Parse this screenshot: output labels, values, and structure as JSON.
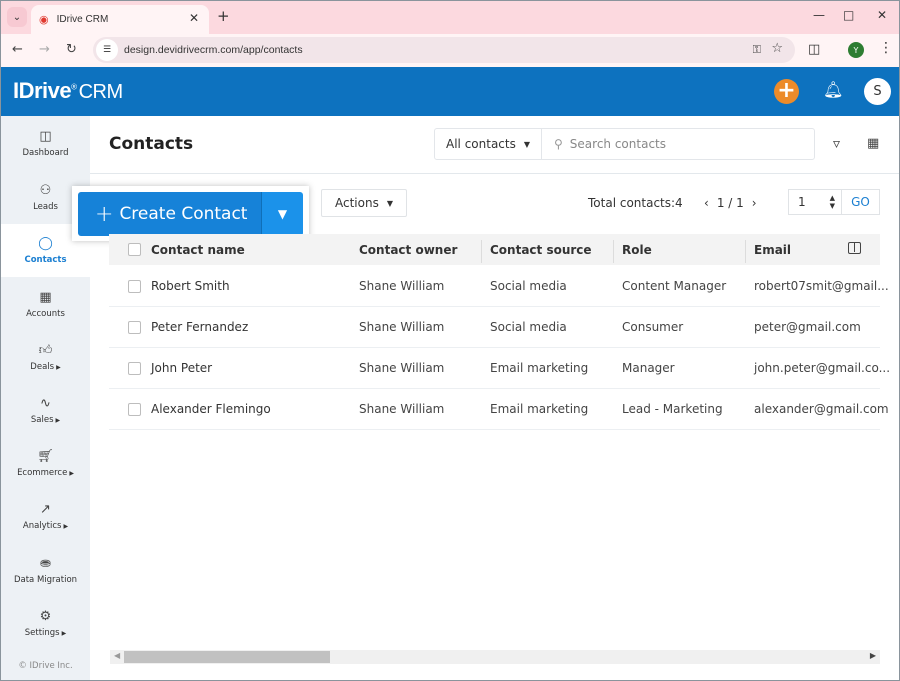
{
  "browser": {
    "tab_title": "IDrive CRM",
    "url": "design.devidrivecrm.com/app/contacts",
    "profile_initial": "Y"
  },
  "app": {
    "logo_brand": "IDrive",
    "logo_registered": "®",
    "logo_product": "CRM",
    "user_initial": "S",
    "accent_color": "#0d72bf",
    "add_button_color": "#ec8b2a"
  },
  "sidebar": {
    "items": [
      {
        "label": "Dashboard",
        "icon": "dashboard-icon",
        "has_submenu": false
      },
      {
        "label": "Leads",
        "icon": "leads-icon",
        "has_submenu": false
      },
      {
        "label": "Contacts",
        "icon": "contacts-icon",
        "has_submenu": false,
        "active": true
      },
      {
        "label": "Accounts",
        "icon": "accounts-icon",
        "has_submenu": false
      },
      {
        "label": "Deals",
        "icon": "deals-icon",
        "has_submenu": true
      },
      {
        "label": "Sales",
        "icon": "sales-icon",
        "has_submenu": true
      },
      {
        "label": "Ecommerce",
        "icon": "ecommerce-icon",
        "has_submenu": true
      },
      {
        "label": "Analytics",
        "icon": "analytics-icon",
        "has_submenu": true
      },
      {
        "label": "Data Migration",
        "icon": "data-migration-icon",
        "has_submenu": false
      },
      {
        "label": "Settings",
        "icon": "settings-icon",
        "has_submenu": true
      }
    ],
    "copyright": "© IDrive Inc."
  },
  "main": {
    "title": "Contacts",
    "view_select": "All contacts",
    "search_placeholder": "Search contacts",
    "create_button": "Create Contact",
    "actions_label": "Actions",
    "total_label": "Total contacts:",
    "total_count": "4",
    "page_indicator": "1 / 1",
    "page_input": "1",
    "go_label": "GO"
  },
  "table": {
    "columns": [
      "Contact name",
      "Contact owner",
      "Contact source",
      "Role",
      "Email"
    ],
    "rows": [
      {
        "name": "Robert Smith",
        "owner": "Shane William",
        "source": "Social media",
        "role": "Content Manager",
        "email": "robert07smit@gmail..."
      },
      {
        "name": "Peter Fernandez",
        "owner": "Shane William",
        "source": "Social media",
        "role": "Consumer",
        "email": "peter@gmail.com"
      },
      {
        "name": "John Peter",
        "owner": "Shane William",
        "source": "Email marketing",
        "role": "Manager",
        "email": "john.peter@gmail.co..."
      },
      {
        "name": "Alexander Flemingo",
        "owner": "Shane William",
        "source": "Email marketing",
        "role": "Lead - Marketing",
        "email": "alexander@gmail.com"
      }
    ]
  }
}
